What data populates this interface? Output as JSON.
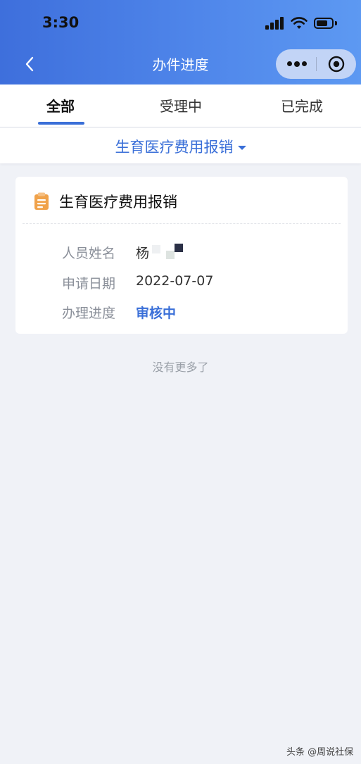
{
  "status_bar": {
    "time": "3:30"
  },
  "nav": {
    "title": "办件进度",
    "back_icon": "chevron-left-icon",
    "more_icon": "more-dots-icon",
    "close_icon": "target-icon"
  },
  "tabs": [
    {
      "label": "全部",
      "active": true
    },
    {
      "label": "受理中",
      "active": false
    },
    {
      "label": "已完成",
      "active": false
    }
  ],
  "filter": {
    "label": "生育医疗费用报销",
    "icon": "caret-down-icon"
  },
  "card": {
    "icon": "clipboard-icon",
    "title": "生育医疗费用报销",
    "rows": [
      {
        "label": "人员姓名",
        "value": "杨"
      },
      {
        "label": "申请日期",
        "value": "2022-07-07"
      },
      {
        "label": "办理进度",
        "value": "审核中"
      }
    ]
  },
  "footer": {
    "no_more": "没有更多了"
  },
  "watermark": "头条 @周说社保",
  "colors": {
    "accent": "#3a6fd8",
    "header_start": "#3e6fdc",
    "header_end": "#5d99f2",
    "card_icon": "#f0a24a"
  }
}
